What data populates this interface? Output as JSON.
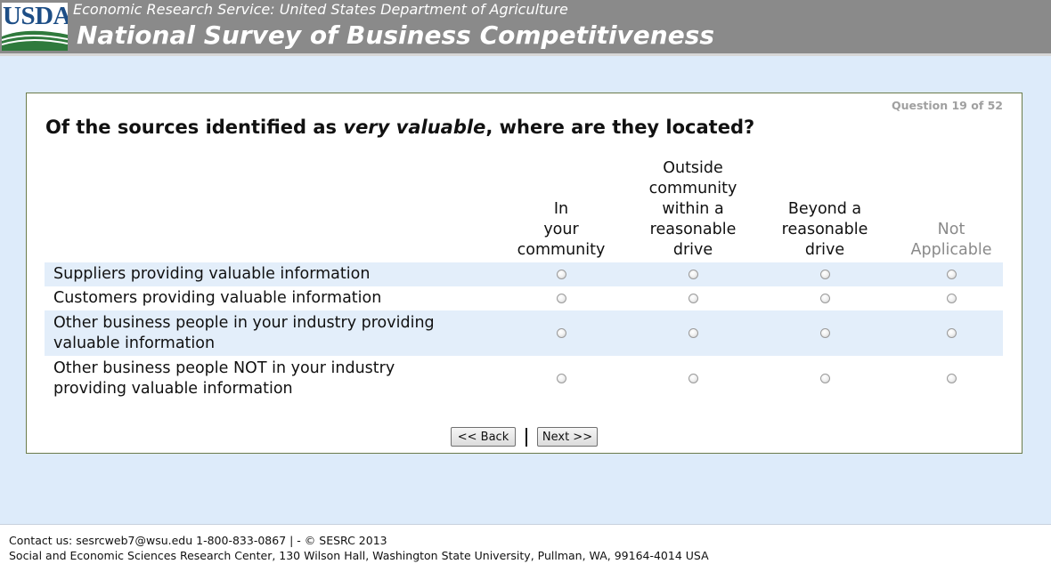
{
  "header": {
    "logo_text": "USDA",
    "agency": "Economic Research Service: United States Department of Agriculture",
    "title": "National Survey of Business Competitiveness"
  },
  "survey": {
    "progress": "Question 19 of 52",
    "question_before": "Of the sources identified as ",
    "question_emphasis": "very valuable",
    "question_after": ", where are they located?",
    "columns": [
      [
        "In",
        "your",
        "community"
      ],
      [
        "Outside",
        "community",
        "within a",
        "reasonable",
        "drive"
      ],
      [
        "Beyond a",
        "reasonable",
        "drive"
      ],
      [
        "Not",
        "Applicable"
      ]
    ],
    "rows": [
      [
        "Suppliers providing valuable information"
      ],
      [
        "Customers providing valuable information"
      ],
      [
        "Other business people in your industry providing",
        "valuable information"
      ],
      [
        "Other business people NOT in your industry",
        "providing valuable information"
      ]
    ],
    "selected": [
      null,
      null,
      null,
      null
    ]
  },
  "nav": {
    "back_label": "<< Back",
    "next_label": "Next >>"
  },
  "footer": {
    "contact": "Contact us: sesrcweb7@wsu.edu 1-800-833-0867 | - © SESRC 2013",
    "address": "Social and Economic Sciences Research Center, 130 Wilson Hall, Washington State University, Pullman, WA, 99164-4014 USA"
  },
  "colors": {
    "header_bg": "#8a8a8a",
    "page_bg": "#ddebfa",
    "row_shade": "#e3eefa",
    "usda_blue": "#1d4e86",
    "usda_green": "#2f7a3c"
  }
}
